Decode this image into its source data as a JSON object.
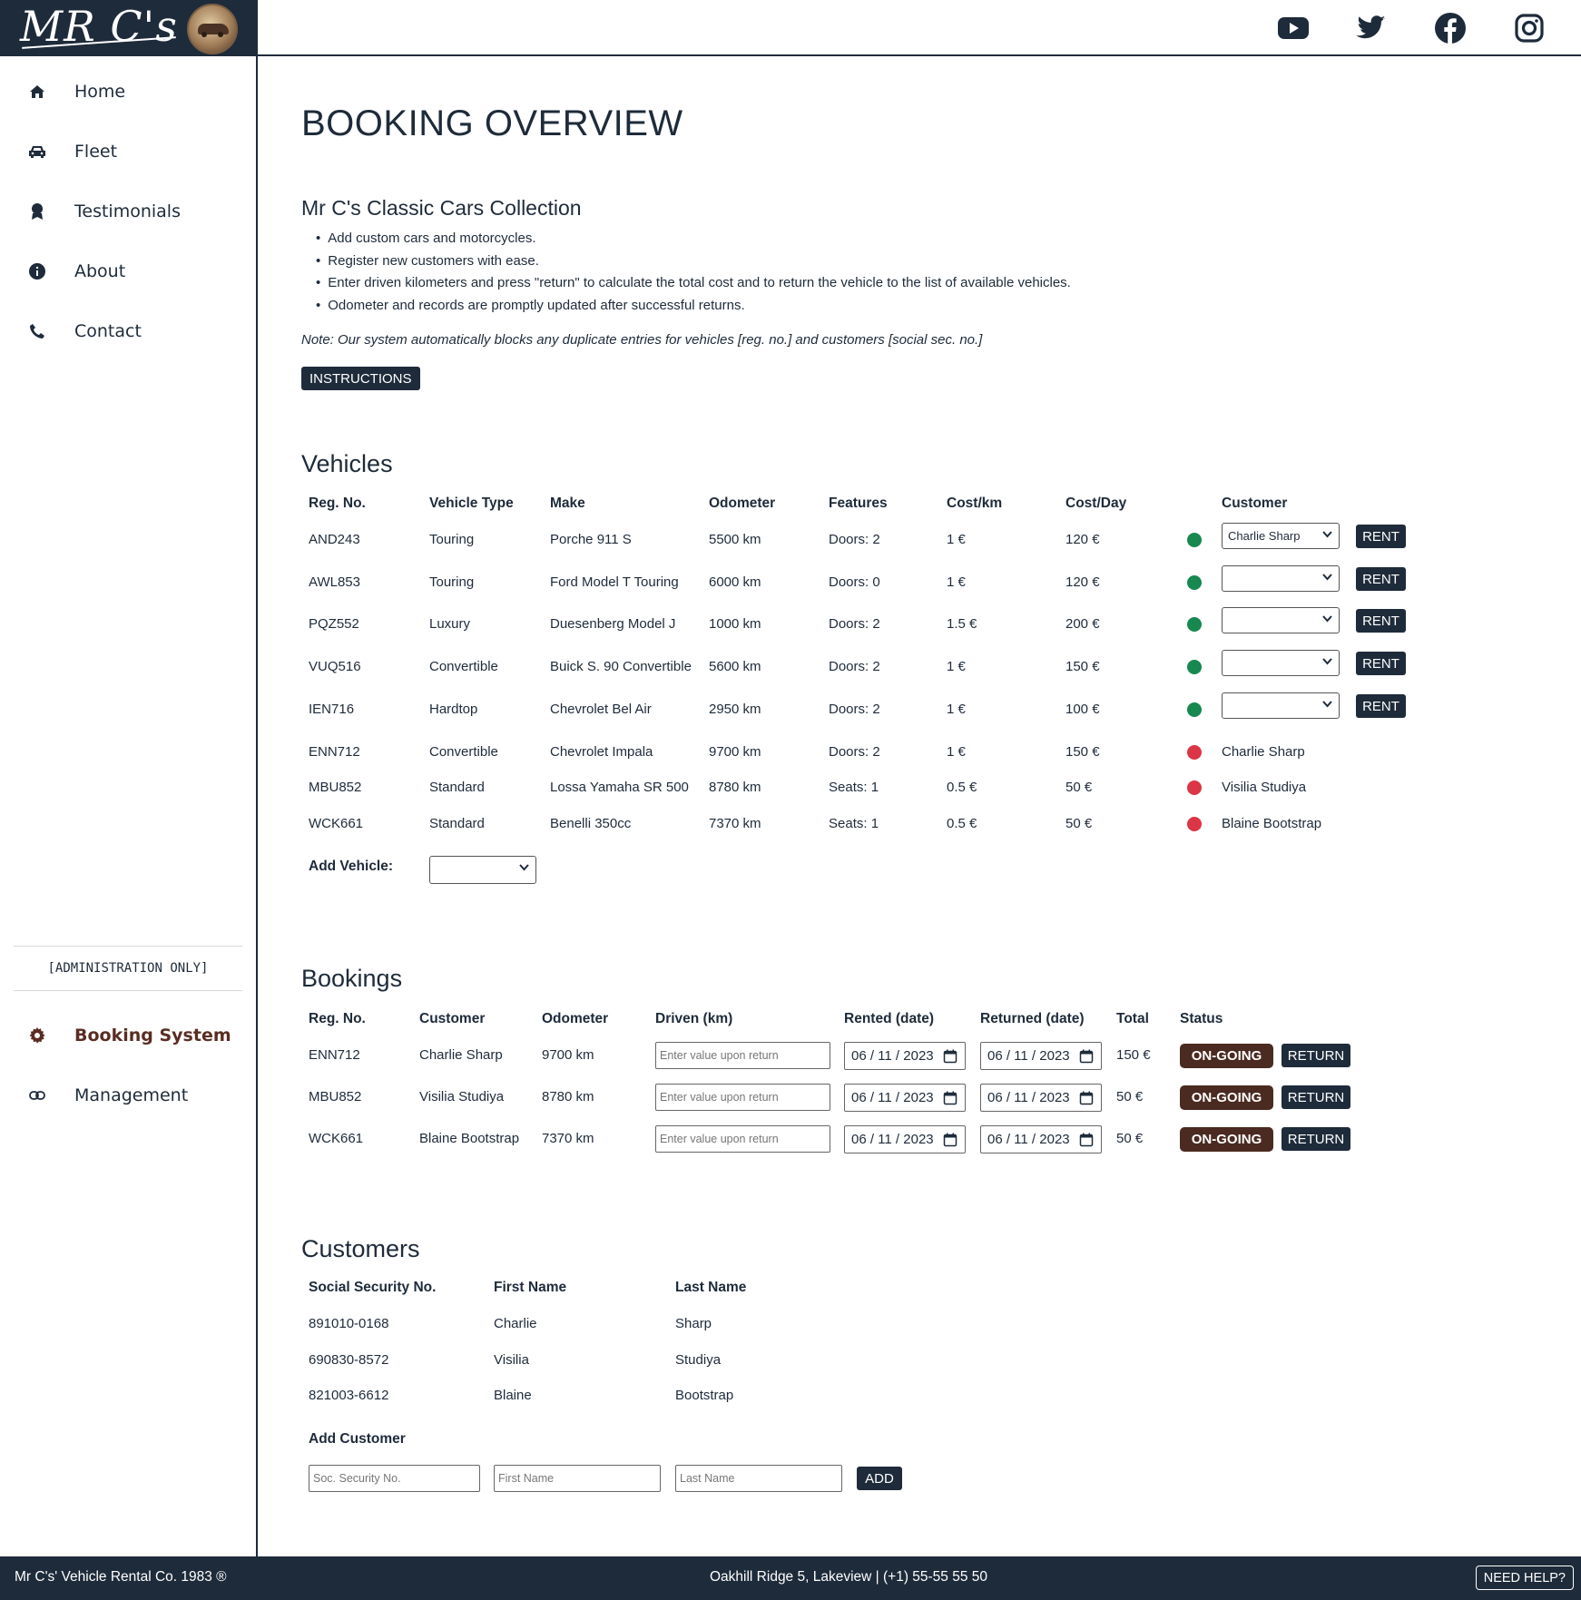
{
  "brand": {
    "logo_text": "MR C's"
  },
  "nav": {
    "items": [
      {
        "label": "Home",
        "icon": "home-icon"
      },
      {
        "label": "Fleet",
        "icon": "car-icon"
      },
      {
        "label": "Testimonials",
        "icon": "award-icon"
      },
      {
        "label": "About",
        "icon": "info-icon"
      },
      {
        "label": "Contact",
        "icon": "phone-icon"
      }
    ],
    "admin_label": "[ADMINISTRATION ONLY]",
    "admin_items": [
      {
        "label": "Booking System",
        "icon": "gear-icon",
        "active": true
      },
      {
        "label": "Management",
        "icon": "link-icon"
      }
    ]
  },
  "social": [
    "youtube-icon",
    "twitter-icon",
    "facebook-icon",
    "instagram-icon"
  ],
  "page": {
    "title": "BOOKING OVERVIEW",
    "subtitle": "Mr C's Classic Cars Collection",
    "bullets": [
      "Add custom cars and motorcycles.",
      "Register new customers with ease.",
      "Enter driven kilometers and press \"return\" to calculate the total cost and to return the vehicle to the list of available vehicles.",
      "Odometer and records are promptly updated after successful returns."
    ],
    "note": "Note: Our system automatically blocks any duplicate entries for vehicles [reg. no.] and customers [social sec. no.]",
    "instructions_label": "INSTRUCTIONS"
  },
  "vehicles": {
    "title": "Vehicles",
    "headers": [
      "Reg. No.",
      "Vehicle Type",
      "Make",
      "Odometer",
      "Features",
      "Cost/km",
      "Cost/Day",
      "Customer"
    ],
    "rows": [
      {
        "reg": "AND243",
        "type": "Touring",
        "make": "Porche 911 S",
        "odometer": "5500 km",
        "features": "Doors: 2",
        "cost_km": "1 €",
        "cost_day": "120 €",
        "available": true,
        "customer": "Charlie Sharp"
      },
      {
        "reg": "AWL853",
        "type": "Touring",
        "make": "Ford Model T Touring",
        "odometer": "6000 km",
        "features": "Doors: 0",
        "cost_km": "1 €",
        "cost_day": "120 €",
        "available": true,
        "customer": ""
      },
      {
        "reg": "PQZ552",
        "type": "Luxury",
        "make": "Duesenberg Model J",
        "odometer": "1000 km",
        "features": "Doors: 2",
        "cost_km": "1.5 €",
        "cost_day": "200 €",
        "available": true,
        "customer": ""
      },
      {
        "reg": "VUQ516",
        "type": "Convertible",
        "make": "Buick S. 90 Convertible",
        "odometer": "5600 km",
        "features": "Doors: 2",
        "cost_km": "1 €",
        "cost_day": "150 €",
        "available": true,
        "customer": ""
      },
      {
        "reg": "IEN716",
        "type": "Hardtop",
        "make": "Chevrolet Bel Air",
        "odometer": "2950 km",
        "features": "Doors: 2",
        "cost_km": "1 €",
        "cost_day": "100 €",
        "available": true,
        "customer": ""
      },
      {
        "reg": "ENN712",
        "type": "Convertible",
        "make": "Chevrolet Impala",
        "odometer": "9700 km",
        "features": "Doors: 2",
        "cost_km": "1 €",
        "cost_day": "150 €",
        "available": false,
        "customer": "Charlie Sharp"
      },
      {
        "reg": "MBU852",
        "type": "Standard",
        "make": "Lossa Yamaha SR 500",
        "odometer": "8780 km",
        "features": "Seats: 1",
        "cost_km": "0.5 €",
        "cost_day": "50 €",
        "available": false,
        "customer": "Visilia Studiya"
      },
      {
        "reg": "WCK661",
        "type": "Standard",
        "make": "Benelli 350cc",
        "odometer": "7370 km",
        "features": "Seats: 1",
        "cost_km": "0.5 €",
        "cost_day": "50 €",
        "available": false,
        "customer": "Blaine Bootstrap"
      }
    ],
    "rent_label": "RENT",
    "add_vehicle_label": "Add Vehicle:",
    "add_vehicle_value": "",
    "status_colors": {
      "available": "#17884f",
      "rented": "#dc3545"
    }
  },
  "bookings": {
    "title": "Bookings",
    "headers": [
      "Reg. No.",
      "Customer",
      "Odometer",
      "Driven (km)",
      "Rented (date)",
      "Returned (date)",
      "Total",
      "Status"
    ],
    "rows": [
      {
        "reg": "ENN712",
        "customer": "Charlie Sharp",
        "odometer": "9700 km",
        "driven_placeholder": "Enter value upon return",
        "rented": "06 / 11 / 2023",
        "returned": "06 / 11 / 2023",
        "total": "150 €",
        "status": "ON-GOING"
      },
      {
        "reg": "MBU852",
        "customer": "Visilia Studiya",
        "odometer": "8780 km",
        "driven_placeholder": "Enter value upon return",
        "rented": "06 / 11 / 2023",
        "returned": "06 / 11 / 2023",
        "total": "50 €",
        "status": "ON-GOING"
      },
      {
        "reg": "WCK661",
        "customer": "Blaine Bootstrap",
        "odometer": "7370 km",
        "driven_placeholder": "Enter value upon return",
        "rented": "06 / 11 / 2023",
        "returned": "06 / 11 / 2023",
        "total": "50 €",
        "status": "ON-GOING"
      }
    ],
    "return_label": "RETURN"
  },
  "customers": {
    "title": "Customers",
    "headers": [
      "Social Security No.",
      "First Name",
      "Last Name"
    ],
    "rows": [
      {
        "ssn": "891010-0168",
        "first": "Charlie",
        "last": "Sharp"
      },
      {
        "ssn": "690830-8572",
        "first": "Visilia",
        "last": "Studiya"
      },
      {
        "ssn": "821003-6612",
        "first": "Blaine",
        "last": "Bootstrap"
      }
    ],
    "add_title": "Add Customer",
    "placeholders": {
      "ssn": "Soc. Security No.",
      "first": "First Name",
      "last": "Last Name"
    },
    "add_label": "ADD"
  },
  "footer": {
    "left": "Mr C's' Vehicle Rental Co. 1983 ®",
    "center": "Oakhill Ridge 5, Lakeview | (+1) 55-55 55 50",
    "help_label": "NEED HELP?"
  },
  "colors": {
    "primary": "#1e2b3a",
    "badge": "#4a2a21",
    "active_nav": "#5a2d22"
  }
}
